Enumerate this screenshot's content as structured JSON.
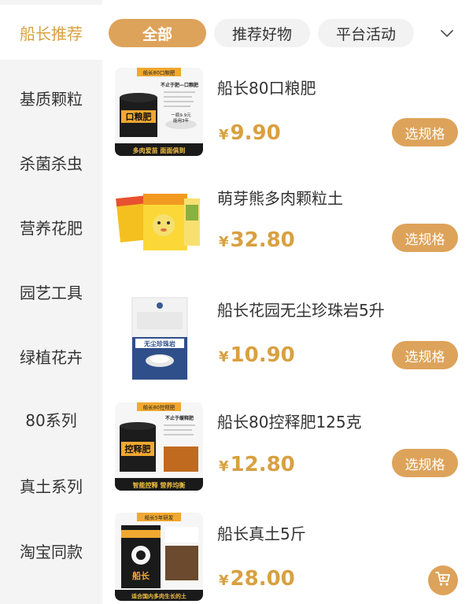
{
  "sidebar": {
    "items": [
      {
        "label": "船长推荐",
        "active": true
      },
      {
        "label": "基质颗粒",
        "active": false
      },
      {
        "label": "杀菌杀虫",
        "active": false
      },
      {
        "label": "营养花肥",
        "active": false
      },
      {
        "label": "园艺工具",
        "active": false
      },
      {
        "label": "绿植花卉",
        "active": false
      },
      {
        "label": "80系列",
        "active": false
      },
      {
        "label": "真土系列",
        "active": false
      },
      {
        "label": "淘宝同款",
        "active": false
      }
    ]
  },
  "tabs": {
    "items": [
      {
        "label": "全部",
        "active": true
      },
      {
        "label": "推荐好物",
        "active": false
      },
      {
        "label": "平台活动",
        "active": false
      }
    ],
    "expand_icon": "chevron-down-icon"
  },
  "products": [
    {
      "name": "船长80口粮肥",
      "currency": "¥",
      "price": "9.90",
      "action": "选规格",
      "image_text": {
        "badge": "船长80口粮肥",
        "headline": "不止于肥—口粮肥",
        "jar_label": "口粮肥",
        "promo": "一瓶9.9元",
        "promo2": "能用3年",
        "footer": "多肉爱苗  面面俱到"
      }
    },
    {
      "name": "萌芽熊多肉颗粒土",
      "currency": "¥",
      "price": "32.80",
      "action": "选规格"
    },
    {
      "name": "船长花园无尘珍珠岩5升",
      "currency": "¥",
      "price": "10.90",
      "action": "选规格",
      "image_text": {
        "bag_label": "无尘珍珠岩"
      }
    },
    {
      "name": "船长80控释肥125克",
      "currency": "¥",
      "price": "12.80",
      "action": "选规格",
      "image_text": {
        "badge": "船长80控释肥",
        "headline": "不止于缓释肥",
        "jar_label": "控释肥",
        "footer": "智能控释  营养均衡"
      }
    },
    {
      "name": "船长真土5斤",
      "currency": "¥",
      "price": "28.00",
      "action": "cart",
      "image_text": {
        "badge": "船长5年研发",
        "bag_label": "船长",
        "footer": "适合国内多肉生长的土"
      }
    }
  ],
  "colors": {
    "accent": "#dda35a",
    "price": "#d9a040",
    "sidebar_bg": "#f4f4f4"
  }
}
